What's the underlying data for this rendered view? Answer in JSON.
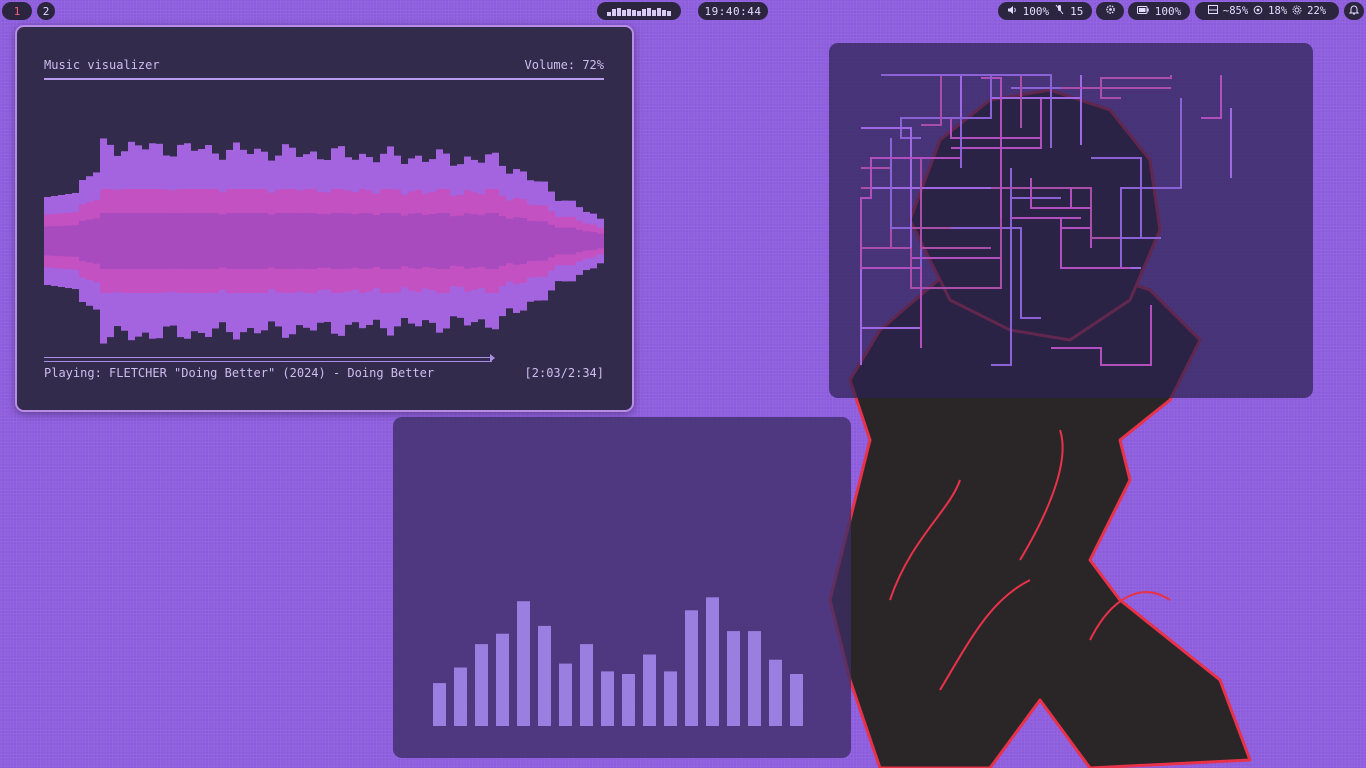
{
  "topbar": {
    "workspaces": [
      "1",
      "2"
    ],
    "clock": "19:40:44",
    "volume_text": "100%",
    "mic_text": "15",
    "battery_text": "100%",
    "disk_text": "~85%",
    "cpu_text": "18%",
    "memory_text": "22%",
    "mini_viz_levels": [
      0.2,
      0.45,
      0.55,
      0.4,
      0.5,
      0.35,
      0.3,
      0.45,
      0.6,
      0.4,
      0.55,
      0.35,
      0.3
    ]
  },
  "visualizer": {
    "title": "Music visualizer",
    "volume": "Volume: 72%",
    "playing": "Playing: FLETCHER \"Doing Better\" (2024) - Doing Better",
    "time": "[2:03/2:34]",
    "progress_fraction": 0.8,
    "colors": {
      "outer": "#a463df",
      "inner": "#c451c1",
      "core": "#a84bbf"
    }
  },
  "bar_visualizer": {
    "levels": [
      0.33,
      0.45,
      0.63,
      0.71,
      0.96,
      0.77,
      0.48,
      0.63,
      0.42,
      0.4,
      0.55,
      0.42,
      0.89,
      0.99,
      0.73,
      0.73,
      0.51,
      0.4
    ],
    "color": "#9a7ee0"
  },
  "circuit_panel": {
    "palette": [
      "#b24fbf",
      "#8a62d6",
      "#a94fa9",
      "#9f69e3"
    ]
  }
}
